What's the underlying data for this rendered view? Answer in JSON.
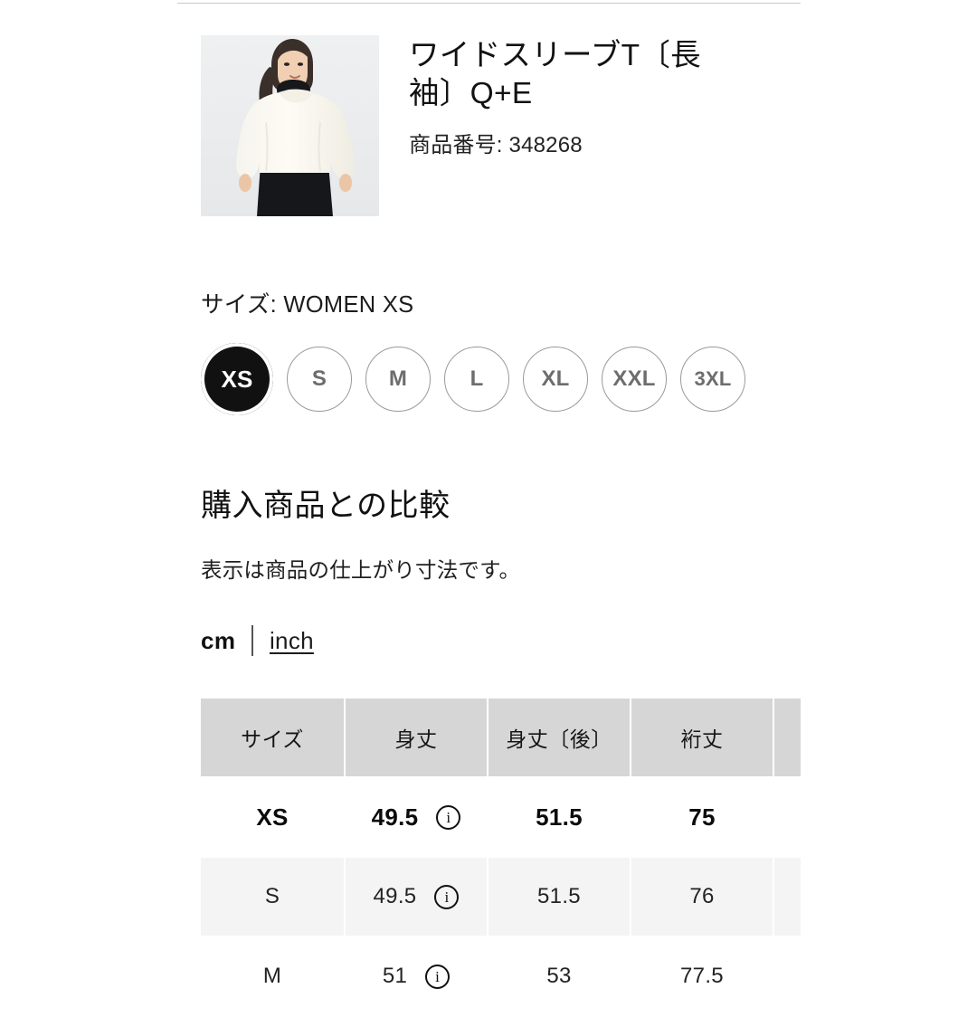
{
  "product": {
    "title": "ワイドスリーブT〔長袖〕Q+E",
    "code_label": "商品番号: 348268",
    "image_alt": "product-photo-model-wearing-white-wide-sleeve-top"
  },
  "size_section": {
    "label": "サイズ: WOMEN XS",
    "selected": "XS",
    "options": [
      {
        "label": "XS",
        "selected": true
      },
      {
        "label": "S",
        "selected": false
      },
      {
        "label": "M",
        "selected": false
      },
      {
        "label": "L",
        "selected": false
      },
      {
        "label": "XL",
        "selected": false
      },
      {
        "label": "XXL",
        "selected": false
      },
      {
        "label": "3XL",
        "selected": false
      }
    ]
  },
  "compare": {
    "heading": "購入商品との比較",
    "note": "表示は商品の仕上がり寸法です。"
  },
  "units": {
    "active": "cm",
    "inactive": "inch"
  },
  "table": {
    "headers": [
      "サイズ",
      "身丈",
      "身丈〔後〕",
      "裄丈",
      ""
    ],
    "rows": [
      {
        "size": "XS",
        "body_length": "49.5",
        "body_length_back": "51.5",
        "sleeve_length": "75",
        "extra": "",
        "has_info": true,
        "state": "current"
      },
      {
        "size": "S",
        "body_length": "49.5",
        "body_length_back": "51.5",
        "sleeve_length": "76",
        "extra": "",
        "has_info": true,
        "state": "alt"
      },
      {
        "size": "M",
        "body_length": "51",
        "body_length_back": "53",
        "sleeve_length": "77.5",
        "extra": "",
        "has_info": true,
        "state": "normal"
      }
    ],
    "info_icon_glyph": "i"
  },
  "colors": {
    "selected_chip_bg": "#111111",
    "chip_border": "#9a9a9a",
    "chip_text": "#6d6d6d",
    "table_header_bg": "#d6d6d6",
    "table_alt_row_bg": "#f4f4f4",
    "divider": "#c9c9c9"
  }
}
